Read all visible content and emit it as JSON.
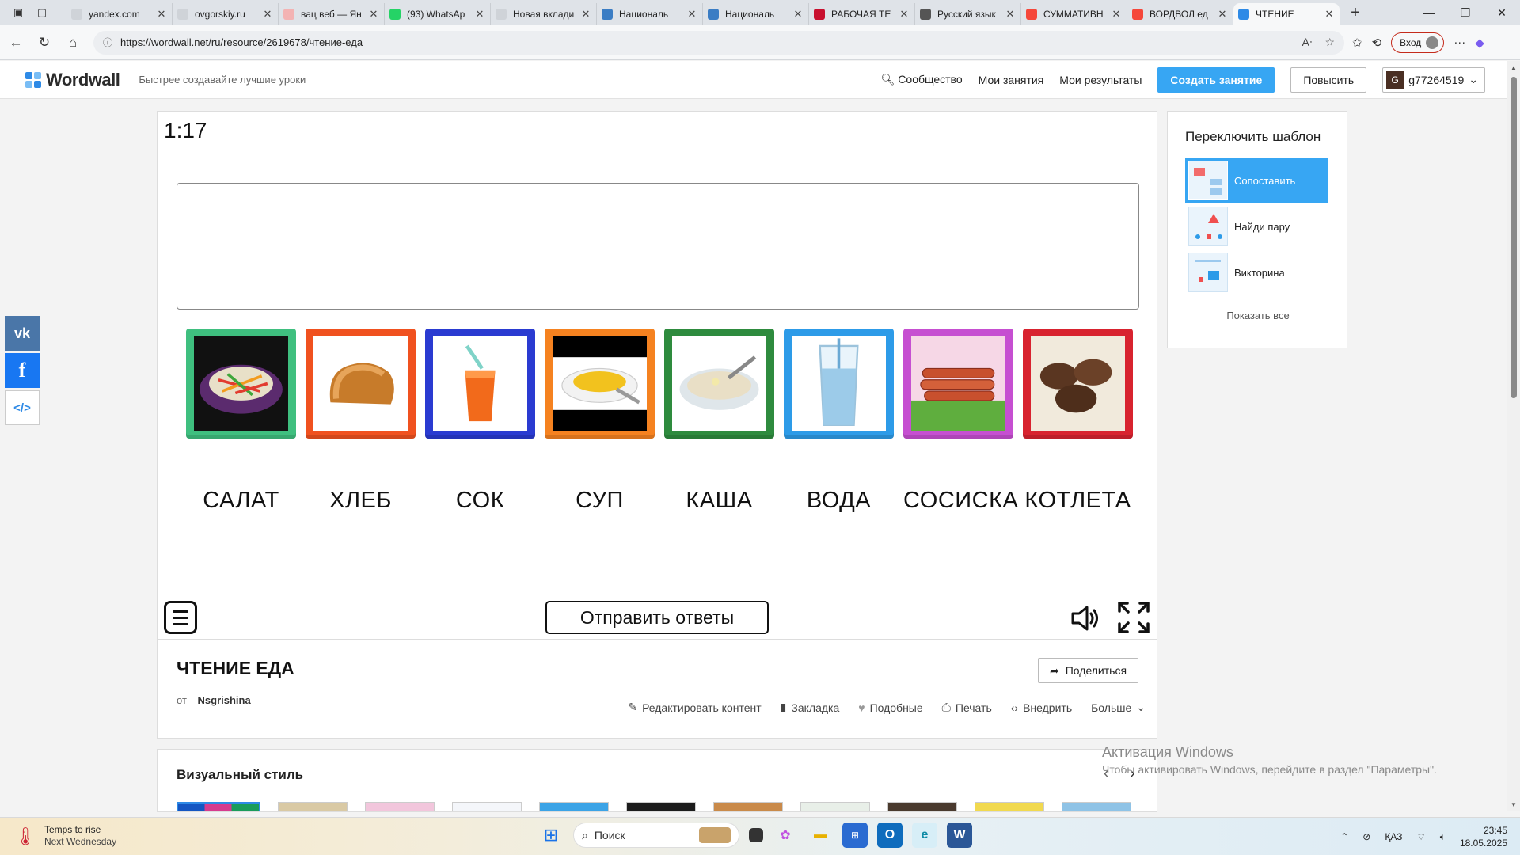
{
  "browser": {
    "tabs": [
      {
        "title": "yandex.com",
        "fav": "#cfd3d8"
      },
      {
        "title": "ovgorskiy.ru",
        "fav": "#cfd3d8"
      },
      {
        "title": "вац веб — Ян",
        "fav": "#f3b3b3"
      },
      {
        "title": "(93) WhatsAp",
        "fav": "#25d366"
      },
      {
        "title": "Новая вклади",
        "fav": "#cfd3d8"
      },
      {
        "title": "Националь",
        "fav": "#3b7dc4"
      },
      {
        "title": "Националь",
        "fav": "#3b7dc4"
      },
      {
        "title": "РАБОЧАЯ ТЕ",
        "fav": "#c8102e"
      },
      {
        "title": "Русский язык",
        "fav": "#555555"
      },
      {
        "title": "СУММАТИВН",
        "fav": "#f5473a"
      },
      {
        "title": "ВОРДВОЛ ед",
        "fav": "#f5473a"
      },
      {
        "title": "ЧТЕНИЕ",
        "fav": "#2e8ae6",
        "active": true
      }
    ],
    "url": "https://wordwall.net/ru/resource/2619678/чтение-еда",
    "login_label": "Вход"
  },
  "header": {
    "logo": "Wordwall",
    "tagline": "Быстрее создавайте лучшие уроки",
    "nav": [
      "Сообщество",
      "Мои занятия",
      "Мои результаты"
    ],
    "create_label": "Создать занятие",
    "upgrade_label": "Повысить",
    "user_initial": "G",
    "username": "g77264519"
  },
  "activity": {
    "timer": "1:17",
    "cards": [
      {
        "name": "salad",
        "border": "#3fbf7f"
      },
      {
        "name": "bread",
        "border": "#f0511f"
      },
      {
        "name": "juice",
        "border": "#2a3bd1"
      },
      {
        "name": "soup",
        "border": "#f58220"
      },
      {
        "name": "porridge",
        "border": "#2e8b3e"
      },
      {
        "name": "water",
        "border": "#2d9be8"
      },
      {
        "name": "sausages",
        "border": "#c64fd1"
      },
      {
        "name": "cutlets",
        "border": "#d8232f"
      }
    ],
    "words": [
      "САЛАТ",
      "ХЛЕБ",
      "СОК",
      "СУП",
      "КАША",
      "ВОДА",
      "СОСИСКА",
      "КОТЛЕТА"
    ],
    "submit_label": "Отправить ответы"
  },
  "info": {
    "title": "ЧТЕНИЕ ЕДА",
    "by_label": "от",
    "author": "Nsgrishina",
    "share_label": "Поделиться",
    "actions": [
      "Редактировать контент",
      "Закладка",
      "Подобные",
      "Печать",
      "Внедрить",
      "Больше"
    ]
  },
  "style_panel": {
    "title": "Визуальный стиль"
  },
  "watermark": {
    "line1": "Активация Windows",
    "line2": "Чтобы активировать Windows, перейдите в раздел \"Параметры\"."
  },
  "switcher": {
    "title": "Переключить шаблон",
    "items": [
      "Сопоставить",
      "Найди пару",
      "Викторина"
    ],
    "show_all": "Показать все"
  },
  "taskbar": {
    "weather_title": "Temps to rise",
    "weather_sub": "Next Wednesday",
    "search_placeholder": "Поиск",
    "lang": "ҚАЗ",
    "time": "23:45",
    "date": "18.05.2025"
  }
}
